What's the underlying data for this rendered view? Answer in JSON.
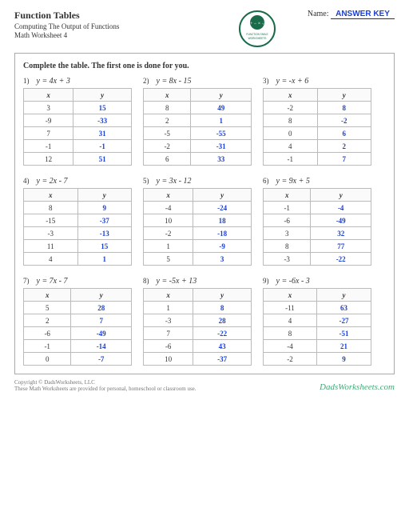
{
  "header": {
    "title": "Function Tables",
    "subtitle": "Computing The Output of Functions",
    "wsline": "Math Worksheet 4",
    "nameLabel": "Name:",
    "answerKey": "ANSWER KEY",
    "badgeTop": "FUNCTION TABLE",
    "badgeBottom": "WORKSHEETS"
  },
  "instruction": "Complete the table. The first one is done for you.",
  "colX": "x",
  "colY": "y",
  "problems": [
    {
      "n": "1)",
      "eq": "y = 4x + 3",
      "rows": [
        [
          "3",
          "15"
        ],
        [
          "-9",
          "-33"
        ],
        [
          "7",
          "31"
        ],
        [
          "-1",
          "-1"
        ],
        [
          "12",
          "51"
        ]
      ]
    },
    {
      "n": "2)",
      "eq": "y = 8x - 15",
      "rows": [
        [
          "8",
          "49"
        ],
        [
          "2",
          "1"
        ],
        [
          "-5",
          "-55"
        ],
        [
          "-2",
          "-31"
        ],
        [
          "6",
          "33"
        ]
      ]
    },
    {
      "n": "3)",
      "eq": "y = -x + 6",
      "rows": [
        [
          "-2",
          "8"
        ],
        [
          "8",
          "-2"
        ],
        [
          "0",
          "6"
        ],
        [
          "4",
          "2"
        ],
        [
          "-1",
          "7"
        ]
      ]
    },
    {
      "n": "4)",
      "eq": "y = 2x - 7",
      "rows": [
        [
          "8",
          "9"
        ],
        [
          "-15",
          "-37"
        ],
        [
          "-3",
          "-13"
        ],
        [
          "11",
          "15"
        ],
        [
          "4",
          "1"
        ]
      ]
    },
    {
      "n": "5)",
      "eq": "y = 3x - 12",
      "rows": [
        [
          "-4",
          "-24"
        ],
        [
          "10",
          "18"
        ],
        [
          "-2",
          "-18"
        ],
        [
          "1",
          "-9"
        ],
        [
          "5",
          "3"
        ]
      ]
    },
    {
      "n": "6)",
      "eq": "y = 9x + 5",
      "rows": [
        [
          "-1",
          "-4"
        ],
        [
          "-6",
          "-49"
        ],
        [
          "3",
          "32"
        ],
        [
          "8",
          "77"
        ],
        [
          "-3",
          "-22"
        ]
      ]
    },
    {
      "n": "7)",
      "eq": "y = 7x - 7",
      "rows": [
        [
          "5",
          "28"
        ],
        [
          "2",
          "7"
        ],
        [
          "-6",
          "-49"
        ],
        [
          "-1",
          "-14"
        ],
        [
          "0",
          "-7"
        ]
      ]
    },
    {
      "n": "8)",
      "eq": "y = -5x + 13",
      "rows": [
        [
          "1",
          "8"
        ],
        [
          "-3",
          "28"
        ],
        [
          "7",
          "-22"
        ],
        [
          "-6",
          "43"
        ],
        [
          "10",
          "-37"
        ]
      ]
    },
    {
      "n": "9)",
      "eq": "y = -6x - 3",
      "rows": [
        [
          "-11",
          "63"
        ],
        [
          "4",
          "-27"
        ],
        [
          "8",
          "-51"
        ],
        [
          "-4",
          "21"
        ],
        [
          "-2",
          "9"
        ]
      ]
    }
  ],
  "footer": {
    "copy": "Copyright © DadsWorksheets, LLC",
    "note": "These Math Worksheets are provided for personal, homeschool or classroom use.",
    "brand": "DadsWorksheets.com"
  }
}
